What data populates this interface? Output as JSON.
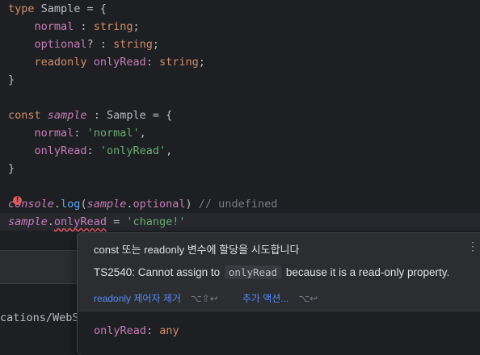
{
  "editor": {
    "lines": {
      "l1": {
        "kw": "type",
        "name": " Sample = {"
      },
      "l2": {
        "prop": "normal",
        "sep": " : ",
        "type": "string",
        "end": ";"
      },
      "l3": {
        "prop": "optional",
        "sep": "? : ",
        "type": "string",
        "end": ";"
      },
      "l4": {
        "kw": "readonly",
        "prop": "onlyRead",
        "sep": ": ",
        "type": "string",
        "end": ";"
      },
      "l5": {
        "text": "}"
      },
      "l6": {
        "kw": "const",
        "var": "sample",
        "rest": " : Sample = {"
      },
      "l7": {
        "prop": "normal",
        "sep": ": ",
        "str": "'normal'",
        "end": ","
      },
      "l8": {
        "prop": "onlyRead",
        "sep": ": ",
        "str": "'onlyRead'",
        "end": ","
      },
      "l9": {
        "text": "}"
      },
      "l10": {
        "obj": "console",
        "dot": ".",
        "fn": "log",
        "open": "(",
        "var": "sample",
        "dot2": ".",
        "prop": "optional",
        "close": ")",
        "comment": " // undefined"
      },
      "l11": {
        "var": "sample",
        "dot": ".",
        "prop": "onlyRead",
        "eq": " = ",
        "str": "'change!'"
      }
    },
    "error_marker": "!"
  },
  "terminal": {
    "path_text": "cations/WebS"
  },
  "popup": {
    "title": "const 또는 readonly 변수에 할당을 시도합니다",
    "menu_icon": "⋮",
    "message_prefix": "TS2540: Cannot assign to",
    "message_code": "onlyRead",
    "message_suffix": "because it is a read-only property.",
    "actions": [
      {
        "label": "readonly 제어자 제거",
        "shortcut": "⌥⇧↩"
      },
      {
        "label": "추가 액션...",
        "shortcut": "⌥↩"
      }
    ],
    "footer": {
      "name": "onlyRead",
      "sep": ": ",
      "type": "any"
    }
  }
}
